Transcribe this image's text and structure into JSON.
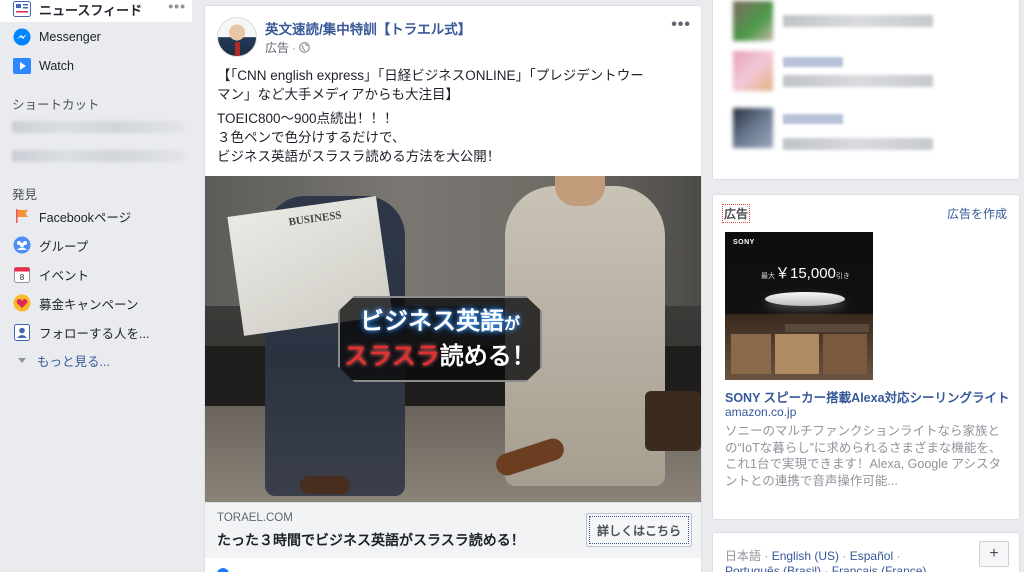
{
  "sidebar": {
    "news_feed": "ニュースフィード",
    "more_dots": "•••",
    "messenger": "Messenger",
    "watch": "Watch",
    "shortcuts_title": "ショートカット",
    "explore_title": "発見",
    "explore_items": [
      {
        "label": "Facebookページ",
        "icon": "flag-icon"
      },
      {
        "label": "グループ",
        "icon": "groups-icon"
      },
      {
        "label": "イベント",
        "icon": "calendar-icon"
      },
      {
        "label": "募金キャンペーン",
        "icon": "fundraiser-icon"
      },
      {
        "label": "フォローする人を...",
        "icon": "follow-icon"
      }
    ],
    "see_more": "もっと見る..."
  },
  "post": {
    "page_name": "英文速読/集中特訓【トラエル式】",
    "sponsored": "広告",
    "text_lines": [
      "【「CNN english express」「日経ビジネスONLINE」「プレジデントウー",
      "マン」など大手メディアからも大注目】",
      "TOEIC800～900点続出！！！",
      "３色ペンで色分けするだけで、",
      "ビジネス英語がスラスラ読める方法を大公開！"
    ],
    "banner_line1_main": "ビジネス英語",
    "banner_line1_small": "が",
    "banner_line2_red": "スラスラ",
    "banner_line2_rest": "読める！",
    "link_domain": "TORAEL.COM",
    "link_headline": "たった３時間でビジネス英語がスラスラ読める！",
    "cta_label": "詳しくはこちら"
  },
  "right": {
    "ad_label": "広告",
    "create_ad": "広告を作成",
    "sony_logo": "SONY",
    "sony_price_prefix": "最大",
    "sony_price": "￥15,000",
    "sony_price_suffix": "引き",
    "ad_title": "SONY スピーカー搭載Alexa対応シーリングライト",
    "ad_domain": "amazon.co.jp",
    "ad_desc": "ソニーのマルチファンクションライトなら家族との“IoTな暮らし”に求められるさまざまな機能を、これ1台で実現できます！Alexa, Google アシスタントとの連携で音声操作可能...",
    "footer": {
      "lang_current": "日本語",
      "lang_en": "English (US)",
      "lang_es": "Español",
      "lang_pt": "Português (Brasil)",
      "lang_fr": "Français (France)",
      "sep": "·",
      "plus": "+"
    }
  },
  "colors": {
    "link_blue": "#365899",
    "page_bg": "#e9ebee",
    "fb_blue": "#1877f2"
  }
}
